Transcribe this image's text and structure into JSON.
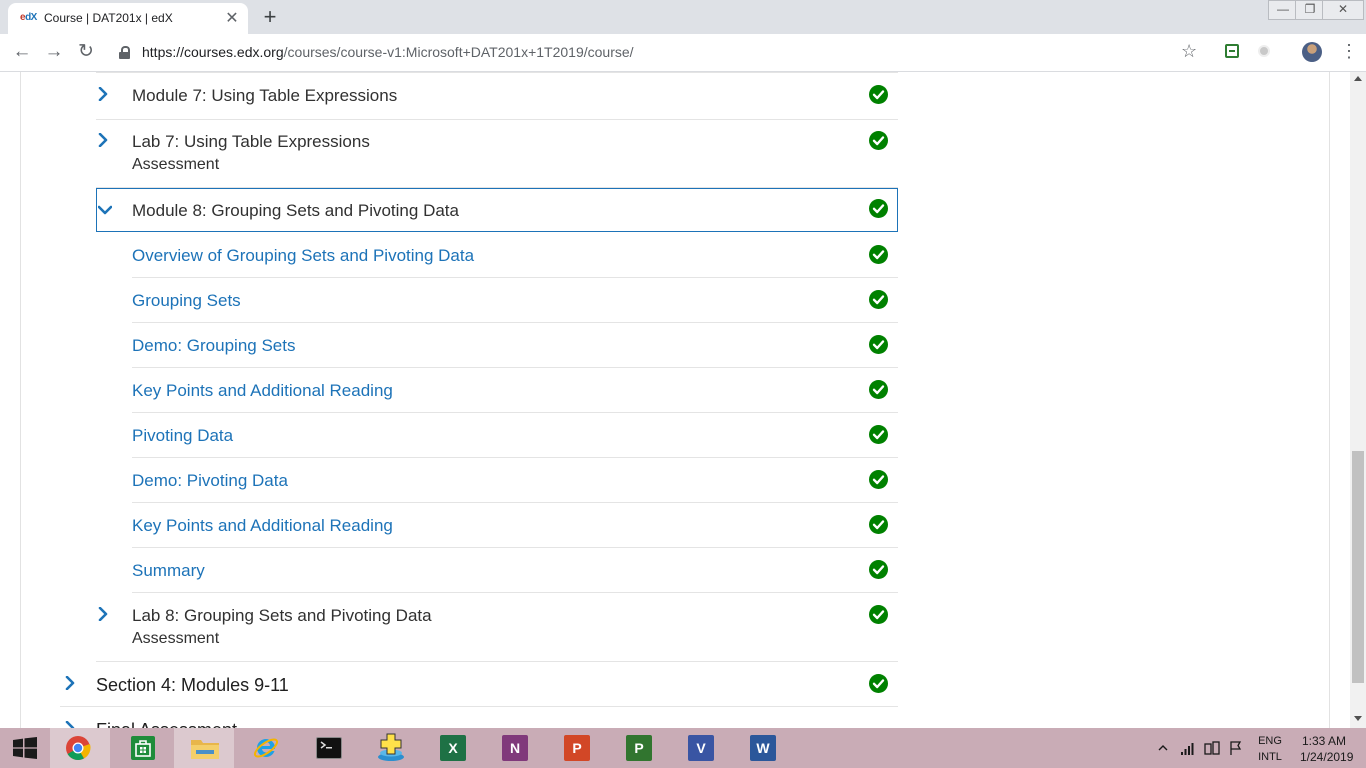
{
  "browser": {
    "tab_favicon_e": "e",
    "tab_favicon_x": "dX",
    "tab_title": "Course | DAT201x | edX",
    "tab_close": "✕",
    "new_tab": "+",
    "url_host": "https://courses.edx.org",
    "url_path": "/courses/course-v1:Microsoft+DAT201x+1T2019/course/",
    "back": "←",
    "forward": "→",
    "reload": "↻",
    "star": "☆",
    "menu": "⋮",
    "win_min": "—",
    "win_restore": "❐",
    "win_close": "✕"
  },
  "outline": {
    "rows": [
      {
        "title": "Module 7: Using Table Expressions"
      },
      {
        "title": "Lab 7: Using Table Expressions",
        "subtitle": "Assessment"
      },
      {
        "title": "Module 8: Grouping Sets and Pivoting Data"
      },
      {
        "title": "Overview of Grouping Sets and Pivoting Data"
      },
      {
        "title": "Grouping Sets"
      },
      {
        "title": "Demo: Grouping Sets"
      },
      {
        "title": "Key Points and Additional Reading"
      },
      {
        "title": "Pivoting Data"
      },
      {
        "title": "Demo: Pivoting Data"
      },
      {
        "title": "Key Points and Additional Reading"
      },
      {
        "title": "Summary"
      },
      {
        "title": "Lab 8: Grouping Sets and Pivoting Data",
        "subtitle": "Assessment"
      },
      {
        "title": "Section 4: Modules 9-11"
      },
      {
        "title": "Final Assessment"
      }
    ],
    "complete_color": "#008100",
    "link_color": "#1d73b8"
  },
  "taskbar": {
    "excel": "X",
    "onenote": "N",
    "powerpoint": "P",
    "project": "P",
    "visio": "V",
    "word": "W",
    "lang_top": "ENG",
    "lang_bottom": "INTL",
    "time": "1:33 AM",
    "date": "1/24/2019"
  }
}
